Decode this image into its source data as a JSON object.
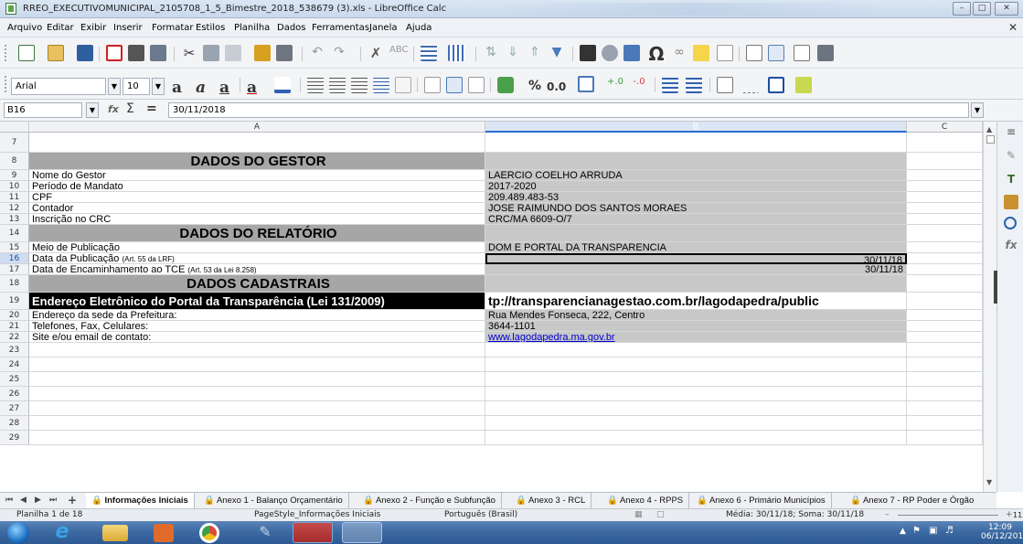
{
  "window": {
    "title": "RREO_EXECUTIVOMUNICIPAL_2105708_1_5_Bimestre_2018_538679 (3).xls - LibreOffice Calc"
  },
  "menu": [
    "Arquivo",
    "Editar",
    "Exibir",
    "Inserir",
    "Formatar",
    "Estilos",
    "Planilha",
    "Dados",
    "Ferramentas",
    "Janela",
    "Ajuda"
  ],
  "format_toolbar": {
    "font_name": "Arial",
    "font_size": "10",
    "percent_label": "%",
    "decimal_label": "0.0"
  },
  "formula_bar": {
    "cell_ref": "B16",
    "formula": "30/11/2018"
  },
  "columns": [
    "A",
    "B",
    "C"
  ],
  "rows": [
    {
      "num": "7",
      "a": "",
      "b": "",
      "style": "plain"
    },
    {
      "num": "8",
      "a": "DADOS DO GESTOR",
      "b": "",
      "style": "header"
    },
    {
      "num": "9",
      "a": "Nome do Gestor",
      "b": "LAERCIO COELHO ARRUDA",
      "style": "gray"
    },
    {
      "num": "10",
      "a": "Período de Mandato",
      "b": "2017-2020",
      "style": "gray"
    },
    {
      "num": "11",
      "a": "CPF",
      "b": "209.489.483-53",
      "style": "gray"
    },
    {
      "num": "12",
      "a": "Contador",
      "b": "JOSE RAIMUNDO DOS SANTOS MORAES",
      "style": "gray"
    },
    {
      "num": "13",
      "a": "Inscrição no CRC",
      "b": "CRC/MA 6609-O/7",
      "style": "gray"
    },
    {
      "num": "14",
      "a": "DADOS DO RELATÓRIO",
      "b": "",
      "style": "header"
    },
    {
      "num": "15",
      "a": "Meio de Publicação",
      "b": "DOM E PORTAL DA TRANSPARENCIA",
      "style": "gray"
    },
    {
      "num": "16",
      "a": "Data da Publicação",
      "a_note": "(Art. 55 da LRF)",
      "b": "30/11/18",
      "style": "gray-right"
    },
    {
      "num": "17",
      "a": "Data de Encaminhamento ao TCE",
      "a_note": "(Art. 53 da Lei 8.258)",
      "b": "30/11/18",
      "style": "gray-right"
    },
    {
      "num": "18",
      "a": "DADOS CADASTRAIS",
      "b": "",
      "style": "header"
    },
    {
      "num": "19",
      "a": "Endereço Eletrônico do Portal da Transparência (Lei 131/2009)",
      "b": "tp://transparencianagestao.com.br/lagodapedra/public",
      "style": "black"
    },
    {
      "num": "20",
      "a": "Endereço da sede da Prefeitura:",
      "b": "Rua Mendes Fonseca, 222, Centro",
      "style": "gray"
    },
    {
      "num": "21",
      "a": "Telefones, Fax, Celulares:",
      "b": "3644-1101",
      "style": "gray"
    },
    {
      "num": "22",
      "a": "Site e/ou email de contato:",
      "b": "www.lagodapedra.ma.gov.br",
      "style": "link"
    },
    {
      "num": "23",
      "a": "",
      "b": "",
      "style": "plain"
    },
    {
      "num": "24",
      "a": "",
      "b": "",
      "style": "plain"
    },
    {
      "num": "25",
      "a": "",
      "b": "",
      "style": "plain"
    },
    {
      "num": "26",
      "a": "",
      "b": "",
      "style": "plain"
    },
    {
      "num": "27",
      "a": "",
      "b": "",
      "style": "plain"
    },
    {
      "num": "28",
      "a": "",
      "b": "",
      "style": "plain"
    },
    {
      "num": "29",
      "a": "",
      "b": "",
      "style": "plain"
    }
  ],
  "sheet_tabs": [
    "Informações Iniciais",
    "Anexo 1 - Balanço Orçamentário",
    "Anexo 2 - Função e Subfunção",
    "Anexo 3 - RCL",
    "Anexo 4 - RPPS",
    "Anexo 6 - Primário Municípios",
    "Anexo 7 - RP Poder e Órgão"
  ],
  "status_bar": {
    "sheet": "Planilha 1 de 18",
    "page_style": "PageStyle_Informações Iniciais",
    "language": "Português (Brasil)",
    "summary": "Média: 30/11/18; Soma: 30/11/18",
    "zoom": "115%"
  },
  "taskbar": {
    "time": "12:09",
    "date": "06/12/2018"
  }
}
